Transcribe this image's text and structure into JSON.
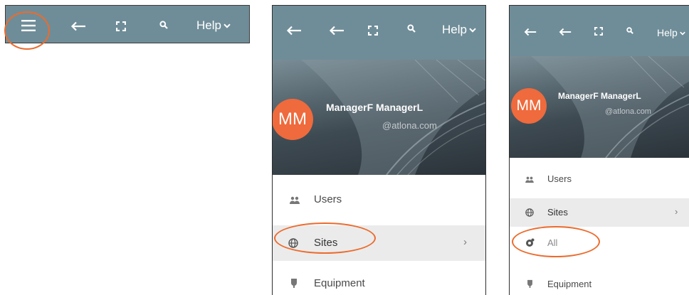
{
  "toolbar": {
    "help_label": "Help"
  },
  "profile": {
    "initials": "MM",
    "name": "ManagerF ManagerL",
    "email": "@atlona.com"
  },
  "menu": {
    "users": "Users",
    "sites": "Sites",
    "all": "All",
    "equipment": "Equipment",
    "chevron": "›"
  },
  "colors": {
    "toolbar_bg": "#6f8d98",
    "highlight_oval": "#ec6b2d",
    "avatar_bg": "#ef6a3c",
    "selected_row_bg": "#ebebeb"
  },
  "icons": [
    "menu-icon",
    "back-arrow-icon",
    "fullscreen-icon",
    "search-icon",
    "chevron-down-icon",
    "users-icon",
    "globe-icon",
    "location-icon",
    "equipment-icon"
  ]
}
